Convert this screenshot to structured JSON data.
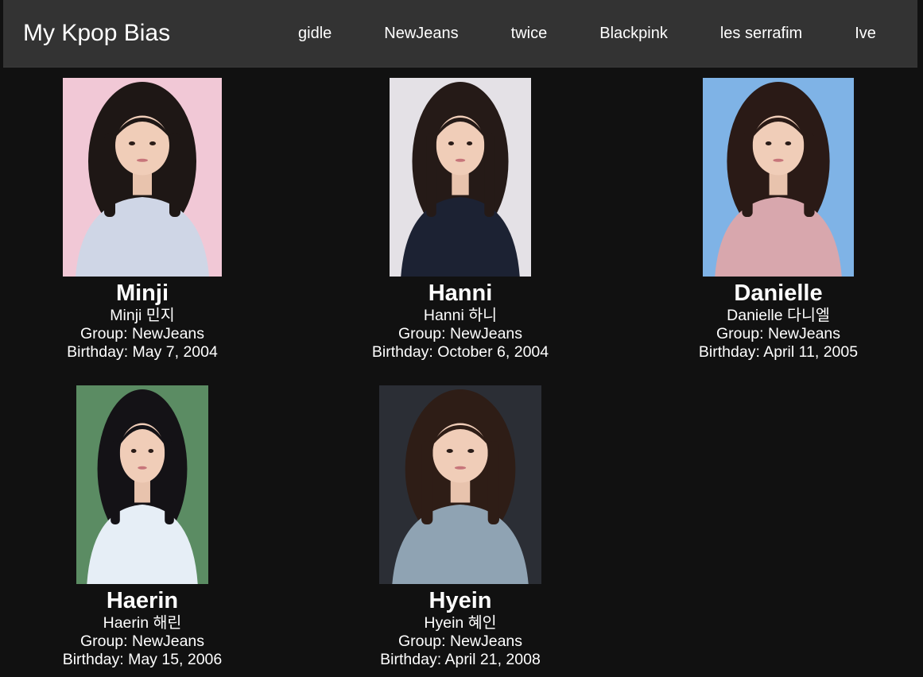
{
  "header": {
    "brand": "My Kpop Bias",
    "nav": [
      {
        "label": "gidle"
      },
      {
        "label": "NewJeans"
      },
      {
        "label": "twice"
      },
      {
        "label": "Blackpink"
      },
      {
        "label": "les serrafim"
      },
      {
        "label": "Ive"
      }
    ]
  },
  "members": [
    {
      "name": "Minji",
      "native": "Minji 민지",
      "group": "Group: NewJeans",
      "birthday": "Birthday: May 7, 2004",
      "photo_alt": "Minji photo",
      "bg_color": "#f1c8d6",
      "hair_color": "#1e1715",
      "outfit_color": "#cfd6e6"
    },
    {
      "name": "Hanni",
      "native": "Hanni 하니",
      "group": "Group: NewJeans",
      "birthday": "Birthday: October 6, 2004",
      "photo_alt": "Hanni photo",
      "bg_color": "#e4e1e6",
      "hair_color": "#251a17",
      "outfit_color": "#1c2233"
    },
    {
      "name": "Danielle",
      "native": "Danielle 다니엘",
      "group": "Group: NewJeans",
      "birthday": "Birthday: April 11, 2005",
      "photo_alt": "Danielle photo",
      "bg_color": "#7fb3e6",
      "hair_color": "#2a1a16",
      "outfit_color": "#d8a7ad"
    },
    {
      "name": "Haerin",
      "native": "Haerin 해린",
      "group": "Group: NewJeans",
      "birthday": "Birthday: May 15, 2006",
      "photo_alt": "Haerin photo",
      "bg_color": "#5b8c63",
      "hair_color": "#141216",
      "outfit_color": "#e6eef6"
    },
    {
      "name": "Hyein",
      "native": "Hyein 혜인",
      "group": "Group: NewJeans",
      "birthday": "Birthday: April 21, 2008",
      "photo_alt": "Hyein photo",
      "bg_color": "#2b2e35",
      "hair_color": "#2e1d16",
      "outfit_color": "#8fa3b3"
    }
  ]
}
